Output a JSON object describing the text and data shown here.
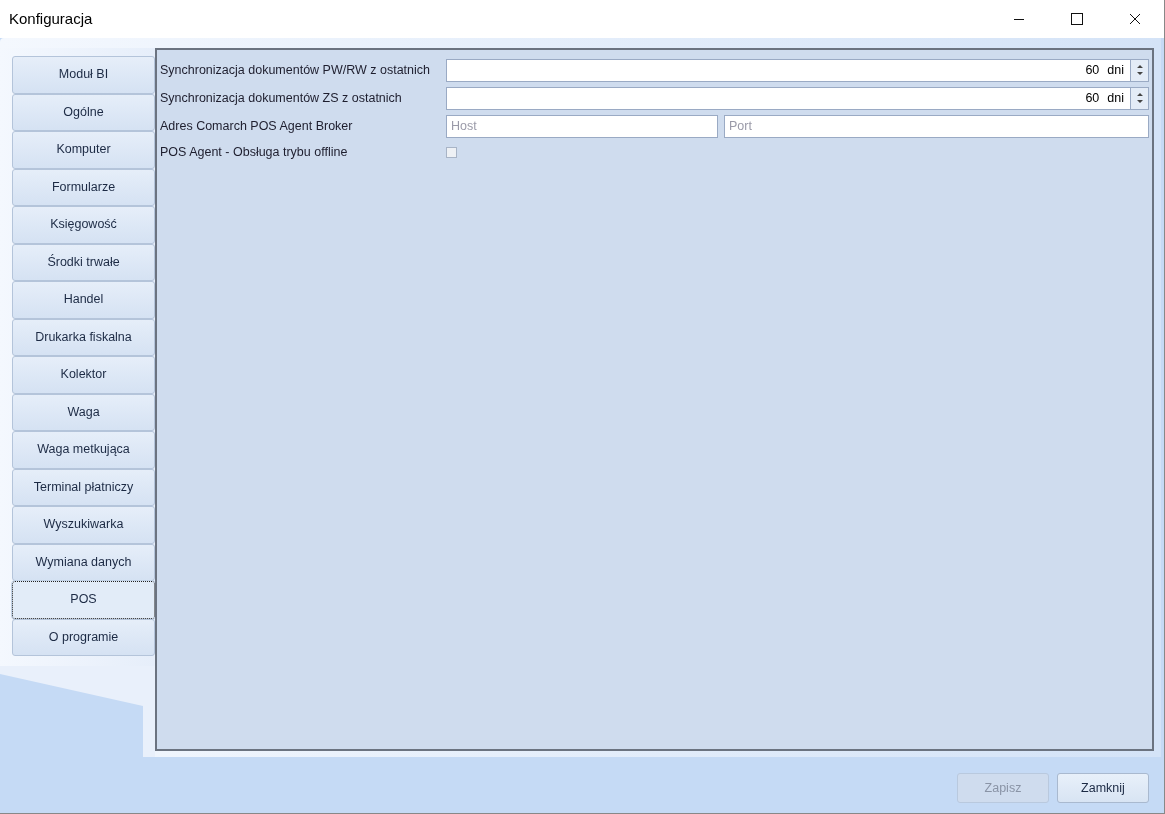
{
  "window": {
    "title": "Konfiguracja"
  },
  "nav": [
    {
      "label": "Moduł BI",
      "selected": false
    },
    {
      "label": "Ogólne",
      "selected": false
    },
    {
      "label": "Komputer",
      "selected": false
    },
    {
      "label": "Formularze",
      "selected": false
    },
    {
      "label": "Księgowość",
      "selected": false
    },
    {
      "label": "Środki trwałe",
      "selected": false
    },
    {
      "label": "Handel",
      "selected": false
    },
    {
      "label": "Drukarka fiskalna",
      "selected": false
    },
    {
      "label": "Kolektor",
      "selected": false
    },
    {
      "label": "Waga",
      "selected": false
    },
    {
      "label": "Waga metkująca",
      "selected": false
    },
    {
      "label": "Terminal płatniczy",
      "selected": false
    },
    {
      "label": "Wyszukiwarka",
      "selected": false
    },
    {
      "label": "Wymiana danych",
      "selected": false
    },
    {
      "label": "POS",
      "selected": true
    },
    {
      "label": "O programie",
      "selected": false
    }
  ],
  "settings": [
    {
      "kind": "spinner",
      "label": "Synchronizacja dokumentów PW/RW z ostatnich",
      "value": "60",
      "unit": "dni"
    },
    {
      "kind": "spinner",
      "label": "Synchronizacja dokumentów ZS z ostatnich",
      "value": "60",
      "unit": "dni"
    },
    {
      "kind": "address",
      "label": "Adres Comarch POS Agent Broker",
      "host_placeholder": "Host",
      "port_placeholder": "Port"
    },
    {
      "kind": "checkbox",
      "label": "POS Agent - Obsługa trybu offline",
      "checked": false
    }
  ],
  "buttons": [
    {
      "label": "Zapisz",
      "disabled": true
    },
    {
      "label": "Zamknij",
      "disabled": false
    }
  ]
}
